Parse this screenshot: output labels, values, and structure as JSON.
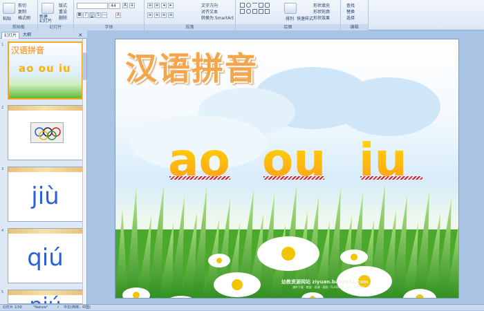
{
  "ribbon": {
    "clipboard": {
      "paste": "粘贴",
      "cut": "剪切",
      "copy": "复制",
      "format_painter": "格式刷",
      "label": "剪贴板"
    },
    "slides": {
      "new_slide": "新建\n幻灯片",
      "layout": "版式",
      "reset": "重设",
      "delete": "删除",
      "label": "幻灯片"
    },
    "font": {
      "name": "",
      "size": "44",
      "label": "字体"
    },
    "paragraph": {
      "text_direction": "文字方向",
      "align_text": "对齐文本",
      "smartart": "转换为 SmartArt",
      "label": "段落"
    },
    "drawing": {
      "arrange": "排列",
      "quick_styles": "快速样式",
      "shape_fill": "形状填充",
      "shape_outline": "形状轮廓",
      "shape_effects": "形状效果",
      "label": "绘图"
    },
    "editing": {
      "find": "查找",
      "replace": "替换",
      "select": "选择",
      "label": "编辑"
    }
  },
  "left_panel": {
    "tab_slides": "幻灯片",
    "tab_outline": "大纲",
    "thumbs": [
      {
        "num": "1",
        "title": "汉语拼音",
        "pinyin": "ao ou iu"
      },
      {
        "num": "2"
      },
      {
        "num": "3",
        "text": "jiù"
      },
      {
        "num": "4",
        "text": "qiú"
      },
      {
        "num": "5",
        "text": "niú"
      }
    ]
  },
  "slide": {
    "title": "汉语拼音",
    "pinyin": [
      "ao",
      "ou",
      "iu"
    ],
    "watermark": "幼教资源网站 ziyuan.baby611.com",
    "watermark_sub": "课件下载 · 教案 · 说课 · 视频 · FLASH课件下载 · 幼教资源"
  },
  "status": {
    "slide_info": "幻灯片 1/30",
    "theme": "\"Nature\"",
    "language": "中文(简体，中国)"
  }
}
